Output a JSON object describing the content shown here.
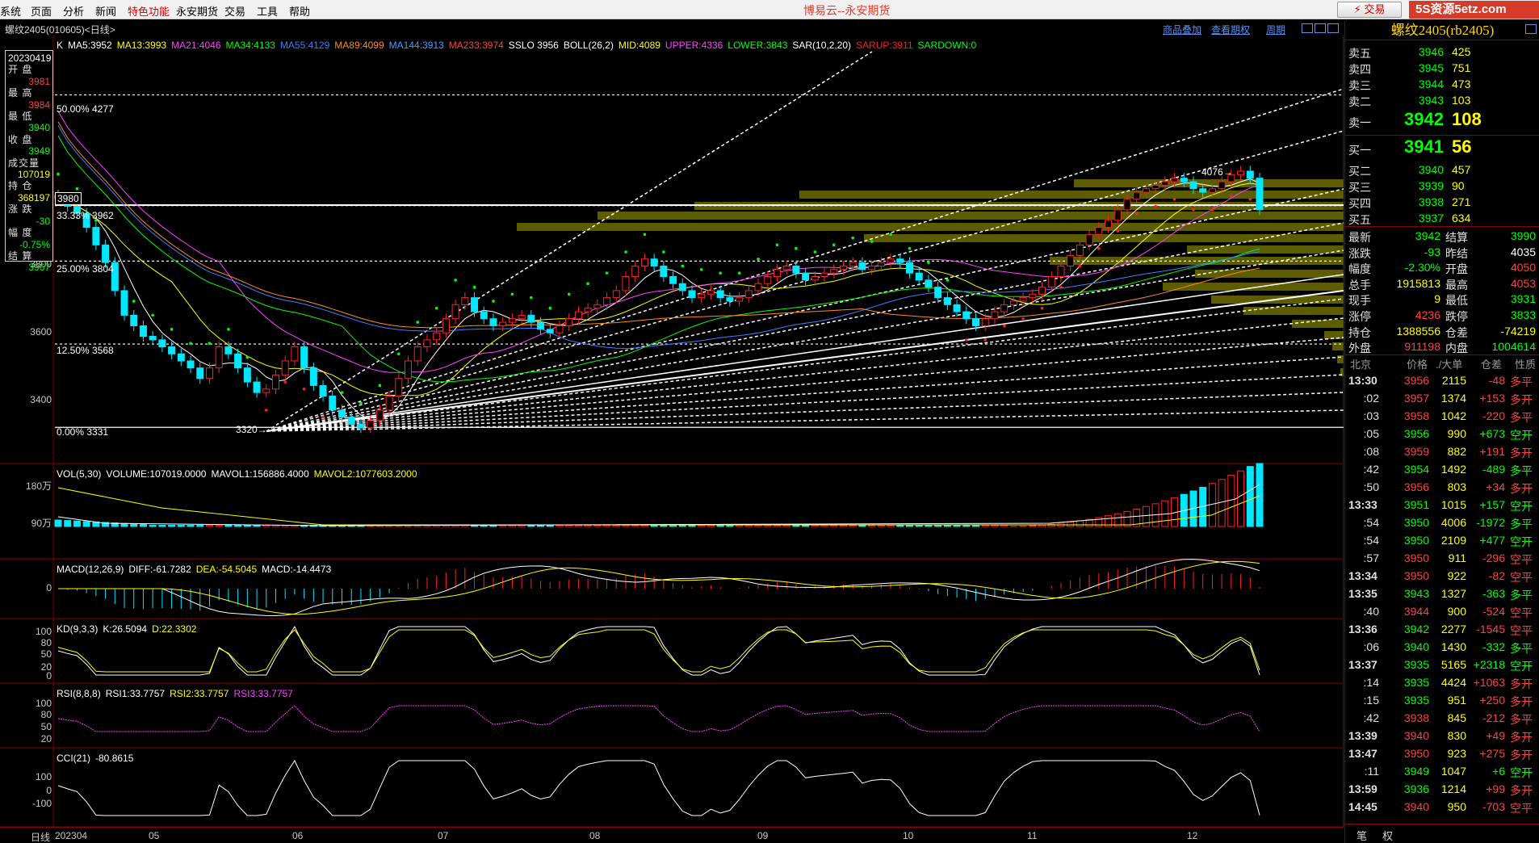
{
  "menu": {
    "items": [
      {
        "label": "系统",
        "special": false
      },
      {
        "label": "页面",
        "special": false
      },
      {
        "label": "分析",
        "special": false
      },
      {
        "label": "新闻",
        "special": false
      },
      {
        "label": "特色功能",
        "special": true
      },
      {
        "label": "永安期货",
        "special": false
      },
      {
        "label": "交易",
        "special": false
      },
      {
        "label": "工具",
        "special": false
      },
      {
        "label": "帮助",
        "special": false
      }
    ],
    "app_title": "博易云--永安期货",
    "trade_button": "⚡ 交易",
    "watermark": "5S资源5etz.com"
  },
  "header": {
    "symbol_title": "螺纹2405(010605)<日线>",
    "links": [
      "商品叠加",
      "查看期权",
      "周期"
    ]
  },
  "indicators": {
    "ma_prefix": "K",
    "ma": [
      {
        "text": "MA5:3952",
        "color": "#ffffff"
      },
      {
        "text": "MA13:3993",
        "color": "#ffff00"
      },
      {
        "text": "MA21:4046",
        "color": "#ff40ff"
      },
      {
        "text": "MA34:4133",
        "color": "#00ff00"
      },
      {
        "text": "MA55:4129",
        "color": "#3f7fff"
      },
      {
        "text": "MA89:4099",
        "color": "#ff8c1a"
      },
      {
        "text": "MA144:3913",
        "color": "#3fa0ff"
      },
      {
        "text": "MA233:3974",
        "color": "#ff4040"
      },
      {
        "text": "SSLO 3956",
        "color": "#ffffff"
      },
      {
        "text": "BOLL(26,2)",
        "color": "#ffffff"
      },
      {
        "text": "MID:4089",
        "color": "#ffff00"
      },
      {
        "text": "UPPER:4336",
        "color": "#ff40ff"
      },
      {
        "text": "LOWER:3843",
        "color": "#00ff00"
      },
      {
        "text": "SAR(10,2,20)",
        "color": "#ffffff"
      },
      {
        "text": "SARUP:3911",
        "color": "#ff2020"
      },
      {
        "text": "SARDOWN:0",
        "color": "#00ff00"
      }
    ],
    "vol": [
      {
        "text": "VOL(5,30)",
        "color": "#ffffff"
      },
      {
        "text": "VOLUME:107019.0000",
        "color": "#ffffff"
      },
      {
        "text": "MAVOL1:156886.4000",
        "color": "#ffffff"
      },
      {
        "text": "MAVOL2:1077603.2000",
        "color": "#ffff00"
      }
    ],
    "macd": [
      {
        "text": "MACD(12,26,9)",
        "color": "#ffffff"
      },
      {
        "text": "DIFF:-61.7282",
        "color": "#ffffff"
      },
      {
        "text": "DEA:-54.5045",
        "color": "#ffff00"
      },
      {
        "text": "MACD:-14.4473",
        "color": "#ffffff"
      }
    ],
    "kd": [
      {
        "text": "KD(9,3,3)",
        "color": "#ffffff"
      },
      {
        "text": "K:26.5094",
        "color": "#ffffff"
      },
      {
        "text": "D:22.3302",
        "color": "#ffff00"
      }
    ],
    "rsi": [
      {
        "text": "RSI(8,8,8)",
        "color": "#ffffff"
      },
      {
        "text": "RSI1:33.7757",
        "color": "#ffffff"
      },
      {
        "text": "RSI2:33.7757",
        "color": "#ffff00"
      },
      {
        "text": "RSI3:33.7757",
        "color": "#ff40ff"
      }
    ],
    "cci": [
      {
        "text": "CCI(21)",
        "color": "#ffffff"
      },
      {
        "text": "-80.8615",
        "color": "#ffffff"
      }
    ]
  },
  "info_box": {
    "lines": [
      {
        "text": "20230419",
        "color": "#ffffff",
        "kind": "val"
      },
      {
        "text": "开  盘",
        "color": "#e0e0e0",
        "kind": "label"
      },
      {
        "text": "3981",
        "color": "#ff4040",
        "kind": "val"
      },
      {
        "text": "最  高",
        "color": "#e0e0e0",
        "kind": "label"
      },
      {
        "text": "3984",
        "color": "#ff4040",
        "kind": "val"
      },
      {
        "text": "最  低",
        "color": "#e0e0e0",
        "kind": "label"
      },
      {
        "text": "3940",
        "color": "#00ff00",
        "kind": "val"
      },
      {
        "text": "收  盘",
        "color": "#e0e0e0",
        "kind": "label"
      },
      {
        "text": "3949",
        "color": "#00ff00",
        "kind": "val"
      },
      {
        "text": "成交量",
        "color": "#e0e0e0",
        "kind": "label"
      },
      {
        "text": "107019",
        "color": "#ffff00",
        "kind": "val"
      },
      {
        "text": "持  仓",
        "color": "#e0e0e0",
        "kind": "label"
      },
      {
        "text": "368197",
        "color": "#ffff00",
        "kind": "val"
      },
      {
        "text": "涨  跌",
        "color": "#e0e0e0",
        "kind": "label"
      },
      {
        "text": "-30",
        "color": "#00ff00",
        "kind": "val"
      },
      {
        "text": "幅  度",
        "color": "#e0e0e0",
        "kind": "label"
      },
      {
        "text": "-0.75%",
        "color": "#00ff00",
        "kind": "val"
      },
      {
        "text": "结  算",
        "color": "#e0e0e0",
        "kind": "label"
      },
      {
        "text": "3967",
        "color": "#00ff00",
        "kind": "val"
      }
    ]
  },
  "main_pane": {
    "y_labels": [
      "3800",
      "3600",
      "3400"
    ],
    "fib_labels": [
      "50.00%  4277",
      "33.33%  3962",
      "25.00%  3804",
      "12.50%  3568",
      "0.00%  3331"
    ],
    "price_tag": "3980",
    "high_marker": "4076→",
    "low_marker": "3320→"
  },
  "vol_pane": {
    "y_labels": [
      "180万",
      "90万"
    ]
  },
  "macd_pane": {
    "y_labels": [
      "0"
    ]
  },
  "kd_pane": {
    "y_labels": [
      "100",
      "80",
      "50",
      "20",
      "0"
    ]
  },
  "rsi_pane": {
    "y_labels": [
      "100",
      "80",
      "50",
      "20"
    ]
  },
  "cci_pane": {
    "y_labels": [
      "100",
      "0",
      "-100"
    ]
  },
  "time_axis": {
    "period_label": "日线",
    "labels": [
      "202304",
      "05",
      "06",
      "07",
      "08",
      "09",
      "10",
      "11",
      "12"
    ]
  },
  "right_panel": {
    "title": "螺纹2405(rb2405)",
    "asks": [
      {
        "label": "卖五",
        "price": "3946",
        "vol": "425"
      },
      {
        "label": "卖四",
        "price": "3945",
        "vol": "751"
      },
      {
        "label": "卖三",
        "price": "3944",
        "vol": "473"
      },
      {
        "label": "卖二",
        "price": "3943",
        "vol": "103"
      },
      {
        "label": "卖一",
        "price": "3942",
        "vol": "108"
      }
    ],
    "bids": [
      {
        "label": "买一",
        "price": "3941",
        "vol": "56"
      },
      {
        "label": "买二",
        "price": "3940",
        "vol": "457"
      },
      {
        "label": "买三",
        "price": "3939",
        "vol": "90"
      },
      {
        "label": "买四",
        "price": "3938",
        "vol": "271"
      },
      {
        "label": "买五",
        "price": "3937",
        "vol": "634"
      }
    ],
    "stats": [
      {
        "l1": "最新",
        "v1": "3942",
        "c1": "#00ff00",
        "l2": "结算",
        "v2": "3990",
        "c2": "#00ff00"
      },
      {
        "l1": "涨跌",
        "v1": "-93",
        "c1": "#00ff00",
        "l2": "昨结",
        "v2": "4035",
        "c2": "#ffffff"
      },
      {
        "l1": "幅度",
        "v1": "-2.30%",
        "c1": "#00ff00",
        "l2": "开盘",
        "v2": "4050",
        "c2": "#ff4040"
      },
      {
        "l1": "总手",
        "v1": "1915813",
        "c1": "#ffff00",
        "l2": "最高",
        "v2": "4053",
        "c2": "#ff4040"
      },
      {
        "l1": "现手",
        "v1": "9",
        "c1": "#ffff00",
        "l2": "最低",
        "v2": "3931",
        "c2": "#00ff00"
      },
      {
        "l1": "涨停",
        "v1": "4236",
        "c1": "#ff4040",
        "l2": "跌停",
        "v2": "3833",
        "c2": "#00ff00"
      },
      {
        "l1": "持仓",
        "v1": "1388556",
        "c1": "#ffff00",
        "l2": "仓差",
        "v2": "-74219",
        "c2": "#ffff00"
      },
      {
        "l1": "外盘",
        "v1": "911198",
        "c1": "#ff4040",
        "l2": "内盘",
        "v2": "1004614",
        "c2": "#00ff00"
      }
    ],
    "ticks_header": {
      "place": "北京",
      "price": "价格",
      "vol": "./大单",
      "oi": "仓差",
      "nature": "性质"
    },
    "ticks": [
      {
        "time": "13:30",
        "price": "3956",
        "vol": "2115",
        "oi": "-48",
        "nature": "多平",
        "major": true,
        "pc": "#ff4040",
        "nc": "#ff4040"
      },
      {
        "time": ":02",
        "price": "3957",
        "vol": "1374",
        "oi": "+153",
        "nature": "多开",
        "major": false,
        "pc": "#ff4040",
        "nc": "#ff4040"
      },
      {
        "time": ":03",
        "price": "3958",
        "vol": "1042",
        "oi": "-220",
        "nature": "多平",
        "major": false,
        "pc": "#ff4040",
        "nc": "#ff4040"
      },
      {
        "time": ":05",
        "price": "3956",
        "vol": "990",
        "oi": "+673",
        "nature": "空开",
        "major": false,
        "pc": "#00ff00",
        "nc": "#00ff00"
      },
      {
        "time": ":08",
        "price": "3959",
        "vol": "882",
        "oi": "+191",
        "nature": "多开",
        "major": false,
        "pc": "#ff4040",
        "nc": "#ff4040"
      },
      {
        "time": ":42",
        "price": "3954",
        "vol": "1492",
        "oi": "-489",
        "nature": "多平",
        "major": false,
        "pc": "#00ff00",
        "nc": "#00ff00"
      },
      {
        "time": ":50",
        "price": "3956",
        "vol": "803",
        "oi": "+34",
        "nature": "多开",
        "major": false,
        "pc": "#ff4040",
        "nc": "#ff4040"
      },
      {
        "time": "13:33",
        "price": "3951",
        "vol": "1015",
        "oi": "+157",
        "nature": "空开",
        "major": true,
        "pc": "#00ff00",
        "nc": "#00ff00"
      },
      {
        "time": ":54",
        "price": "3950",
        "vol": "4006",
        "oi": "-1972",
        "nature": "多平",
        "major": false,
        "pc": "#00ff00",
        "nc": "#00ff00"
      },
      {
        "time": ":54",
        "price": "3950",
        "vol": "2109",
        "oi": "+477",
        "nature": "空开",
        "major": false,
        "pc": "#00ff00",
        "nc": "#00ff00"
      },
      {
        "time": ":57",
        "price": "3950",
        "vol": "911",
        "oi": "-296",
        "nature": "空平",
        "major": false,
        "pc": "#ff4040",
        "nc": "#ff4040"
      },
      {
        "time": "13:34",
        "price": "3950",
        "vol": "922",
        "oi": "-82",
        "nature": "空平",
        "major": true,
        "pc": "#ff4040",
        "nc": "#ff4040"
      },
      {
        "time": "13:35",
        "price": "3943",
        "vol": "1327",
        "oi": "-363",
        "nature": "多平",
        "major": true,
        "pc": "#00ff00",
        "nc": "#00ff00"
      },
      {
        "time": ":40",
        "price": "3944",
        "vol": "900",
        "oi": "-524",
        "nature": "空平",
        "major": false,
        "pc": "#ff4040",
        "nc": "#ff4040"
      },
      {
        "time": "13:36",
        "price": "3942",
        "vol": "2277",
        "oi": "-1545",
        "nature": "空平",
        "major": true,
        "pc": "#00ff00",
        "nc": "#ff4040"
      },
      {
        "time": ":06",
        "price": "3940",
        "vol": "1430",
        "oi": "-332",
        "nature": "多平",
        "major": false,
        "pc": "#00ff00",
        "nc": "#00ff00"
      },
      {
        "time": "13:37",
        "price": "3935",
        "vol": "5165",
        "oi": "+2318",
        "nature": "空开",
        "major": true,
        "pc": "#00ff00",
        "nc": "#00ff00"
      },
      {
        "time": ":14",
        "price": "3935",
        "vol": "4424",
        "oi": "+1063",
        "nature": "多开",
        "major": false,
        "pc": "#00ff00",
        "nc": "#ff4040"
      },
      {
        "time": ":15",
        "price": "3935",
        "vol": "951",
        "oi": "+250",
        "nature": "多开",
        "major": false,
        "pc": "#00ff00",
        "nc": "#ff4040"
      },
      {
        "time": ":42",
        "price": "3938",
        "vol": "845",
        "oi": "-212",
        "nature": "多平",
        "major": false,
        "pc": "#ff4040",
        "nc": "#ff4040"
      },
      {
        "time": "13:39",
        "price": "3940",
        "vol": "830",
        "oi": "+49",
        "nature": "多开",
        "major": true,
        "pc": "#ff4040",
        "nc": "#ff4040"
      },
      {
        "time": "13:47",
        "price": "3950",
        "vol": "923",
        "oi": "+275",
        "nature": "多开",
        "major": true,
        "pc": "#ff4040",
        "nc": "#ff4040"
      },
      {
        "time": ":11",
        "price": "3949",
        "vol": "1047",
        "oi": "+6",
        "nature": "空开",
        "major": false,
        "pc": "#00ff00",
        "nc": "#00ff00"
      },
      {
        "time": "13:59",
        "price": "3936",
        "vol": "1214",
        "oi": "+99",
        "nature": "多开",
        "major": true,
        "pc": "#00ff00",
        "nc": "#ff4040"
      },
      {
        "time": "14:45",
        "price": "3940",
        "vol": "950",
        "oi": "-703",
        "nature": "空平",
        "major": true,
        "pc": "#ff4040",
        "nc": "#ff4040"
      }
    ],
    "bottom_tabs": [
      "笔",
      "权"
    ]
  },
  "colors": {
    "bg": "#000000",
    "grid_red": "#8b0000",
    "candle_up": "#ff2020",
    "candle_down": "#00e8ff",
    "volume_profile": "#6b6b00"
  },
  "chart_data": {
    "type": "candlestick",
    "note_series": "daily bars Apr–Dec",
    "x_labels": [
      "202304",
      "05",
      "06",
      "07",
      "08",
      "09",
      "10",
      "11",
      "12"
    ],
    "y_range": [
      3320,
      4400
    ],
    "close": [
      3982,
      3960,
      3940,
      3900,
      3850,
      3800,
      3720,
      3650,
      3620,
      3590,
      3580,
      3560,
      3540,
      3520,
      3500,
      3470,
      3500,
      3560,
      3540,
      3500,
      3460,
      3430,
      3440,
      3480,
      3520,
      3560,
      3500,
      3450,
      3420,
      3380,
      3360,
      3340,
      3330,
      3350,
      3380,
      3420,
      3470,
      3520,
      3560,
      3580,
      3600,
      3640,
      3680,
      3700,
      3660,
      3640,
      3620,
      3630,
      3640,
      3650,
      3630,
      3610,
      3600,
      3620,
      3640,
      3660,
      3670,
      3680,
      3700,
      3720,
      3760,
      3790,
      3810,
      3790,
      3760,
      3740,
      3720,
      3700,
      3710,
      3720,
      3700,
      3690,
      3700,
      3720,
      3740,
      3760,
      3780,
      3790,
      3770,
      3750,
      3760,
      3770,
      3780,
      3790,
      3800,
      3780,
      3790,
      3800,
      3810,
      3800,
      3770,
      3750,
      3730,
      3700,
      3680,
      3660,
      3640,
      3620,
      3640,
      3660,
      3680,
      3690,
      3700,
      3710,
      3730,
      3760,
      3790,
      3820,
      3850,
      3880,
      3900,
      3920,
      3950,
      3980,
      4000,
      4010,
      4020,
      4030,
      4040,
      4030,
      4010,
      4000,
      4010,
      4030,
      4050,
      4060,
      4040,
      3950
    ],
    "volume_note": "volume rising sharply at end",
    "fib_levels": [
      {
        "pct": "50.00%",
        "price": 4277
      },
      {
        "pct": "33.33%",
        "price": 3962
      },
      {
        "pct": "25.00%",
        "price": 3804
      },
      {
        "pct": "12.50%",
        "price": 3568
      },
      {
        "pct": "0.00%",
        "price": 3331
      }
    ]
  }
}
